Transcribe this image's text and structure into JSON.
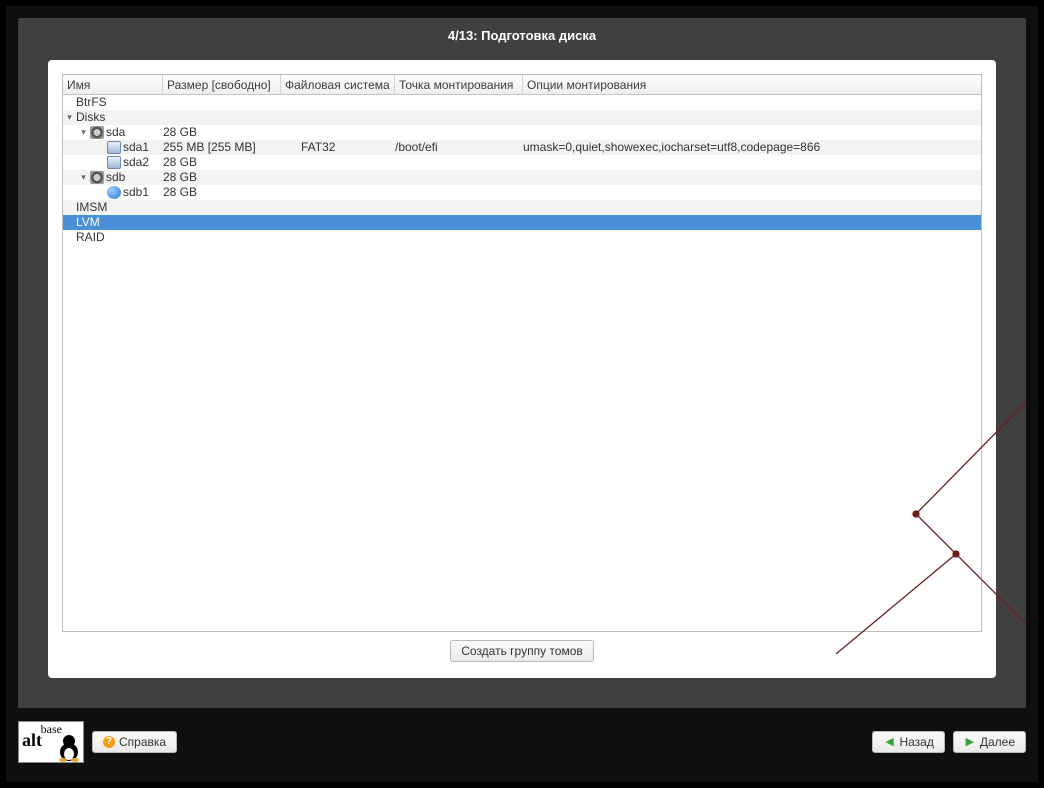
{
  "title": "4/13: Подготовка диска",
  "columns": {
    "name": "Имя",
    "size": "Размер [свободно]",
    "fs": "Файловая система",
    "mount": "Точка монтирования",
    "opts": "Опции монтирования"
  },
  "tree": {
    "btrfs": "BtrFS",
    "disks": "Disks",
    "sda": {
      "name": "sda",
      "size": "28 GB"
    },
    "sda1": {
      "name": "sda1",
      "size": "255 MB [255 MB]",
      "fs": "FAT32",
      "mount": "/boot/efi",
      "opts": "umask=0,quiet,showexec,iocharset=utf8,codepage=866"
    },
    "sda2": {
      "name": "sda2",
      "size": "28 GB"
    },
    "sdb": {
      "name": "sdb",
      "size": "28 GB"
    },
    "sdb1": {
      "name": "sdb1",
      "size": "28 GB"
    },
    "imsm": "IMSM",
    "lvm": "LVM",
    "raid": "RAID"
  },
  "actions": {
    "create_vg": "Создать группу томов"
  },
  "bottom": {
    "help": "Справка",
    "back": "Назад",
    "next": "Далее"
  },
  "logo": {
    "line1": "base",
    "line2": "alt"
  }
}
